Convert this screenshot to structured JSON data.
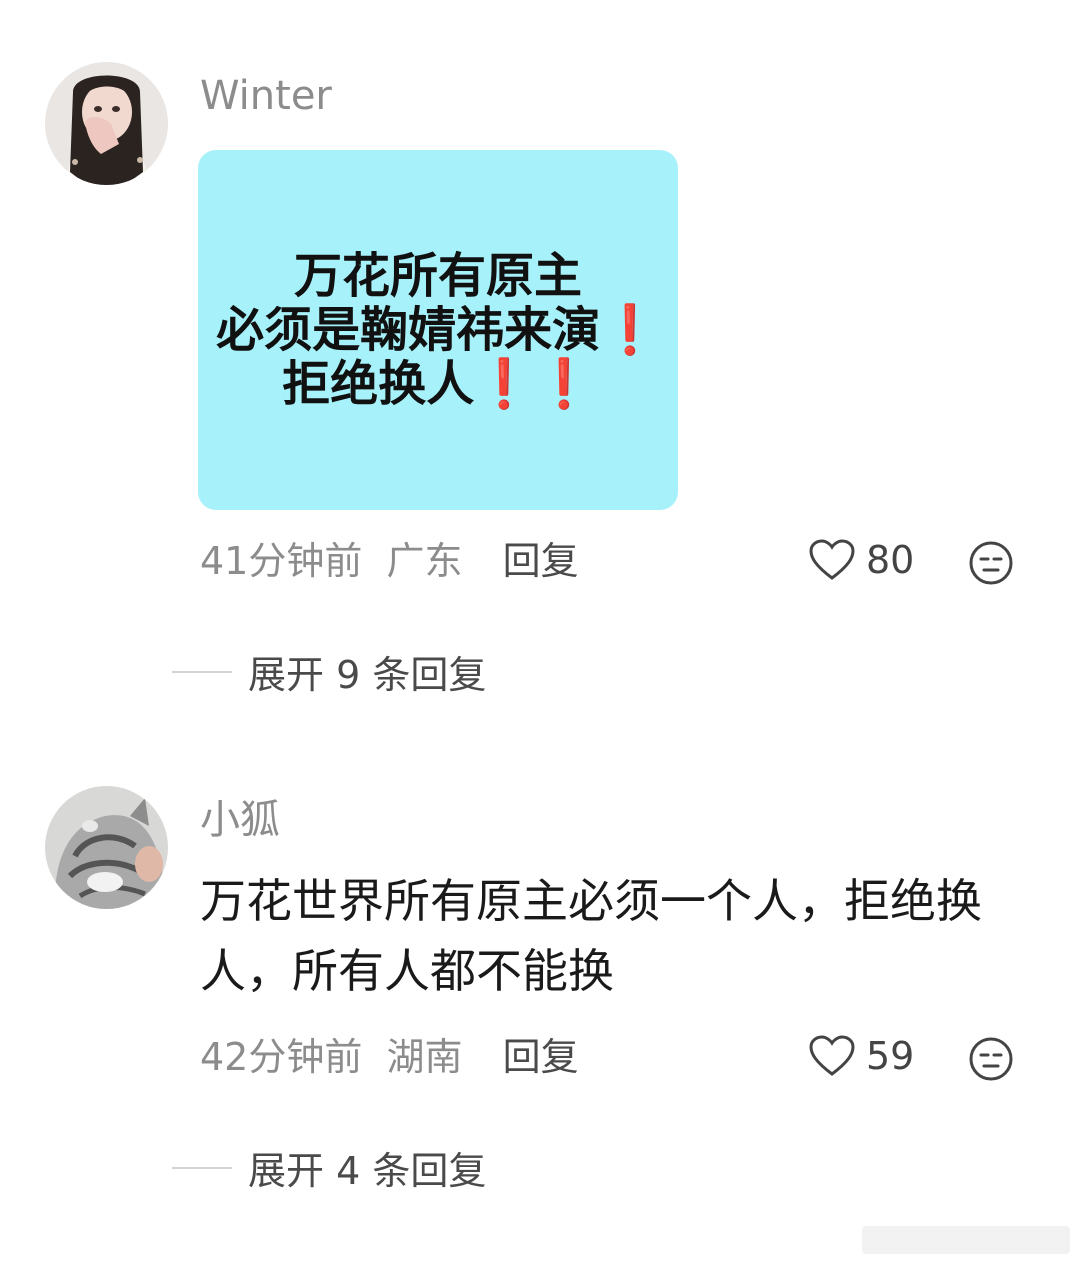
{
  "comments": [
    {
      "username": "Winter",
      "image_lines": [
        "万花所有原主",
        "必须是鞠婧祎来演",
        "拒绝换人"
      ],
      "image_marks": [
        "❗",
        "❗❗"
      ],
      "time": "41分钟前",
      "location": "广东",
      "reply_label": "回复",
      "likes": "80",
      "expand_label": "展开 9 条回复"
    },
    {
      "username": "小狐",
      "text": "万花世界所有原主必须一个人，拒绝换人，所有人都不能换",
      "time": "42分钟前",
      "location": "湖南",
      "reply_label": "回复",
      "likes": "59",
      "expand_label": "展开 4 条回复"
    }
  ]
}
